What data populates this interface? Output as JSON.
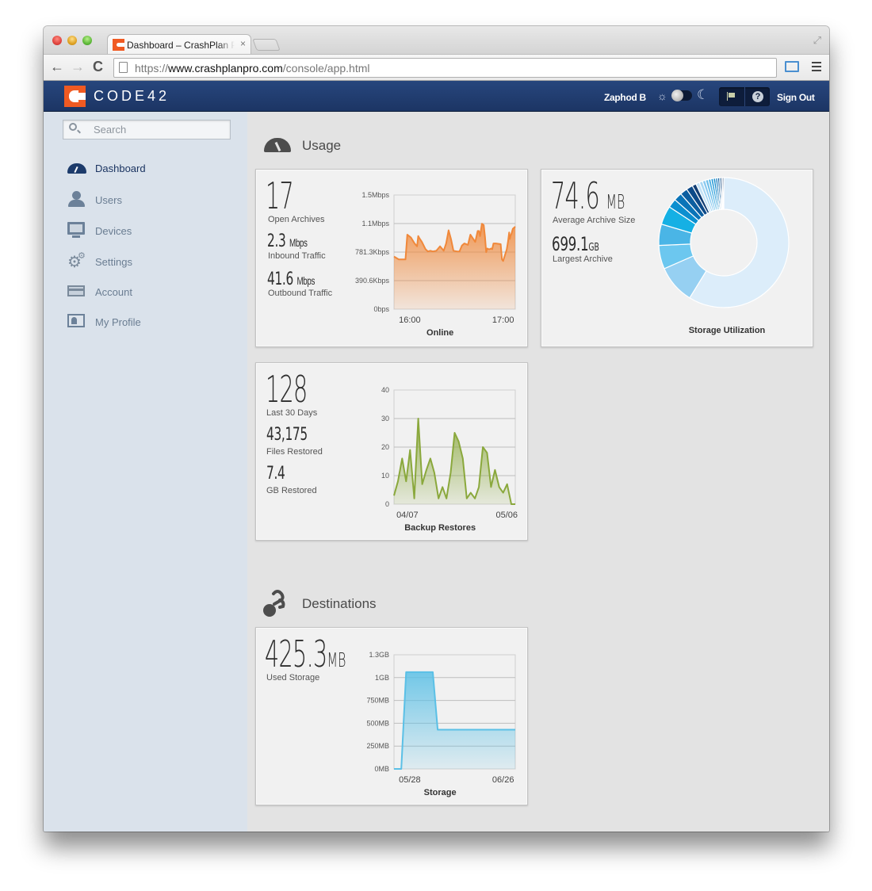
{
  "browser": {
    "tab_title": "Dashboard – CrashPlan PRO",
    "tab_close": "×",
    "url_scheme": "https://",
    "url_host": "www.crashplanpro.com",
    "url_path": "/console/app.html",
    "icons": {
      "back": "←",
      "forward": "→",
      "reload": "C",
      "fullscreen": "⤢"
    }
  },
  "header": {
    "logo_text": "CODE42",
    "user_name": "Zaphod B",
    "sun_icon": "☼",
    "moon_icon": "☾",
    "help_icon": "?",
    "sign_out": "Sign Out"
  },
  "sidebar": {
    "search_placeholder": "Search",
    "items": [
      {
        "label": "Dashboard",
        "icon": "dashboard-gauge-icon",
        "active": true
      },
      {
        "label": "Users",
        "icon": "user-icon",
        "active": false
      },
      {
        "label": "Devices",
        "icon": "monitor-icon",
        "active": false
      },
      {
        "label": "Settings",
        "icon": "gears-icon",
        "active": false
      },
      {
        "label": "Account",
        "icon": "credit-card-icon",
        "active": false
      },
      {
        "label": "My Profile",
        "icon": "profile-card-icon",
        "active": false
      }
    ]
  },
  "main": {
    "usage_title": "Usage",
    "destinations_title": "Destinations",
    "online_card": {
      "open_archives": "17",
      "open_archives_label": "Open Archives",
      "inbound_value": "2.3",
      "inbound_unit": "Mbps",
      "inbound_label": "Inbound Traffic",
      "outbound_value": "41.6",
      "outbound_unit": "Mbps",
      "outbound_label": "Outbound Traffic"
    },
    "storage_card": {
      "avg_value": "74.6",
      "avg_unit": "MB",
      "avg_label": "Average Archive Size",
      "largest_value": "699.1",
      "largest_unit": "GB",
      "largest_label": "Largest Archive"
    },
    "restores_card": {
      "count": "128",
      "count_label": "Last 30 Days",
      "files_value": "43,175",
      "files_label": "Files Restored",
      "gb_value": "7.4",
      "gb_label": "GB Restored"
    },
    "destinations_card": {
      "used_value": "425.3",
      "used_unit": "MB",
      "used_label": "Used Storage"
    }
  },
  "chart_data": [
    {
      "id": "online",
      "type": "area",
      "title": "Online",
      "color": "#f0883a",
      "ylabels": [
        "0bps",
        "390.6Kbps",
        "781.3Kbps",
        "1.1Mbps",
        "1.5Mbps"
      ],
      "ylim": [
        0,
        1562.5
      ],
      "yunit": "Kbps",
      "xticks": [
        "16:00",
        "17:00"
      ],
      "xtick_positions": [
        0.13,
        0.9
      ],
      "x": [
        0,
        0.02,
        0.04,
        0.08,
        0.095,
        0.11,
        0.14,
        0.17,
        0.19,
        0.2,
        0.21,
        0.23,
        0.26,
        0.28,
        0.3,
        0.32,
        0.35,
        0.38,
        0.41,
        0.43,
        0.45,
        0.47,
        0.49,
        0.52,
        0.54,
        0.56,
        0.58,
        0.61,
        0.63,
        0.67,
        0.69,
        0.7,
        0.71,
        0.725,
        0.74,
        0.75,
        0.76,
        0.77,
        0.78,
        0.79,
        0.8,
        0.81,
        0.82,
        0.84,
        0.88,
        0.89,
        0.9,
        0.93,
        0.94,
        0.95,
        0.955,
        0.96,
        0.97,
        0.98,
        1.0
      ],
      "values": [
        720,
        700,
        680,
        680,
        680,
        1020,
        980,
        900,
        860,
        1000,
        970,
        920,
        820,
        790,
        800,
        790,
        800,
        860,
        800,
        900,
        1080,
        960,
        800,
        790,
        790,
        870,
        900,
        880,
        1020,
        920,
        1070,
        1070,
        1000,
        1170,
        1150,
        990,
        780,
        830,
        820,
        820,
        830,
        820,
        900,
        900,
        890,
        680,
        660,
        820,
        920,
        1050,
        960,
        1000,
        1040,
        1100,
        1130
      ]
    },
    {
      "id": "storage-utilization",
      "type": "pie",
      "title": "Storage Utilization",
      "donut": true,
      "slices": [
        {
          "value": 58.0,
          "color": "#dcedfa"
        },
        {
          "value": 9.5,
          "color": "#96d0f2"
        },
        {
          "value": 5.8,
          "color": "#6cc7ef"
        },
        {
          "value": 5.2,
          "color": "#4ab5e6"
        },
        {
          "value": 4.6,
          "color": "#15b0e4"
        },
        {
          "value": 2.2,
          "color": "#0b8fd0"
        },
        {
          "value": 2.0,
          "color": "#0a74b8"
        },
        {
          "value": 1.8,
          "color": "#0c5ea0"
        },
        {
          "value": 1.6,
          "color": "#0d4a88"
        },
        {
          "value": 1.0,
          "color": "#123e74"
        },
        {
          "value": 0.9,
          "color": "#c4e2f6"
        },
        {
          "value": 0.8,
          "color": "#a9d7f3"
        },
        {
          "value": 0.75,
          "color": "#8ccaf0"
        },
        {
          "value": 0.7,
          "color": "#6cbde9"
        },
        {
          "value": 0.65,
          "color": "#4eb0e3"
        },
        {
          "value": 0.6,
          "color": "#2f9fd9"
        },
        {
          "value": 0.55,
          "color": "#1a8ccb"
        },
        {
          "value": 0.5,
          "color": "#1177ba"
        },
        {
          "value": 0.45,
          "color": "#0e62a3"
        },
        {
          "value": 0.4,
          "color": "#0d4f8c"
        },
        {
          "value": 0.35,
          "color": "#0f3f75"
        },
        {
          "value": 0.3,
          "color": "#10335f"
        }
      ]
    },
    {
      "id": "backup-restores",
      "type": "area",
      "title": "Backup Restores",
      "color": "#8aa83c",
      "ylabels": [
        "0",
        "10",
        "20",
        "30",
        "40"
      ],
      "ylim": [
        0,
        40
      ],
      "xticks": [
        "04/07",
        "05/06"
      ],
      "xtick_positions": [
        0.11,
        0.93
      ],
      "x": [
        0,
        0.033,
        0.067,
        0.1,
        0.133,
        0.167,
        0.2,
        0.233,
        0.267,
        0.3,
        0.333,
        0.367,
        0.4,
        0.433,
        0.467,
        0.5,
        0.533,
        0.567,
        0.6,
        0.633,
        0.667,
        0.7,
        0.733,
        0.767,
        0.8,
        0.833,
        0.867,
        0.9,
        0.933,
        0.967,
        1.0
      ],
      "values": [
        3,
        8,
        16,
        8,
        19,
        2,
        30,
        7,
        12,
        16,
        11,
        2,
        6,
        2,
        11,
        25,
        22,
        16,
        2,
        4,
        2,
        6,
        20,
        18,
        6,
        12,
        6,
        4,
        7,
        0,
        0
      ]
    },
    {
      "id": "storage",
      "type": "area",
      "title": "Storage",
      "color": "#5bc0e6",
      "ylabels": [
        "0MB",
        "250MB",
        "500MB",
        "750MB",
        "1GB",
        "1.3GB"
      ],
      "ylim": [
        0,
        1250
      ],
      "yunit": "MB",
      "xticks": [
        "05/28",
        "06/26"
      ],
      "xtick_positions": [
        0.13,
        0.9
      ],
      "x": [
        0,
        0.06,
        0.1,
        0.32,
        0.36,
        1.0
      ],
      "values": [
        0,
        0,
        1060,
        1060,
        430,
        430
      ]
    }
  ]
}
